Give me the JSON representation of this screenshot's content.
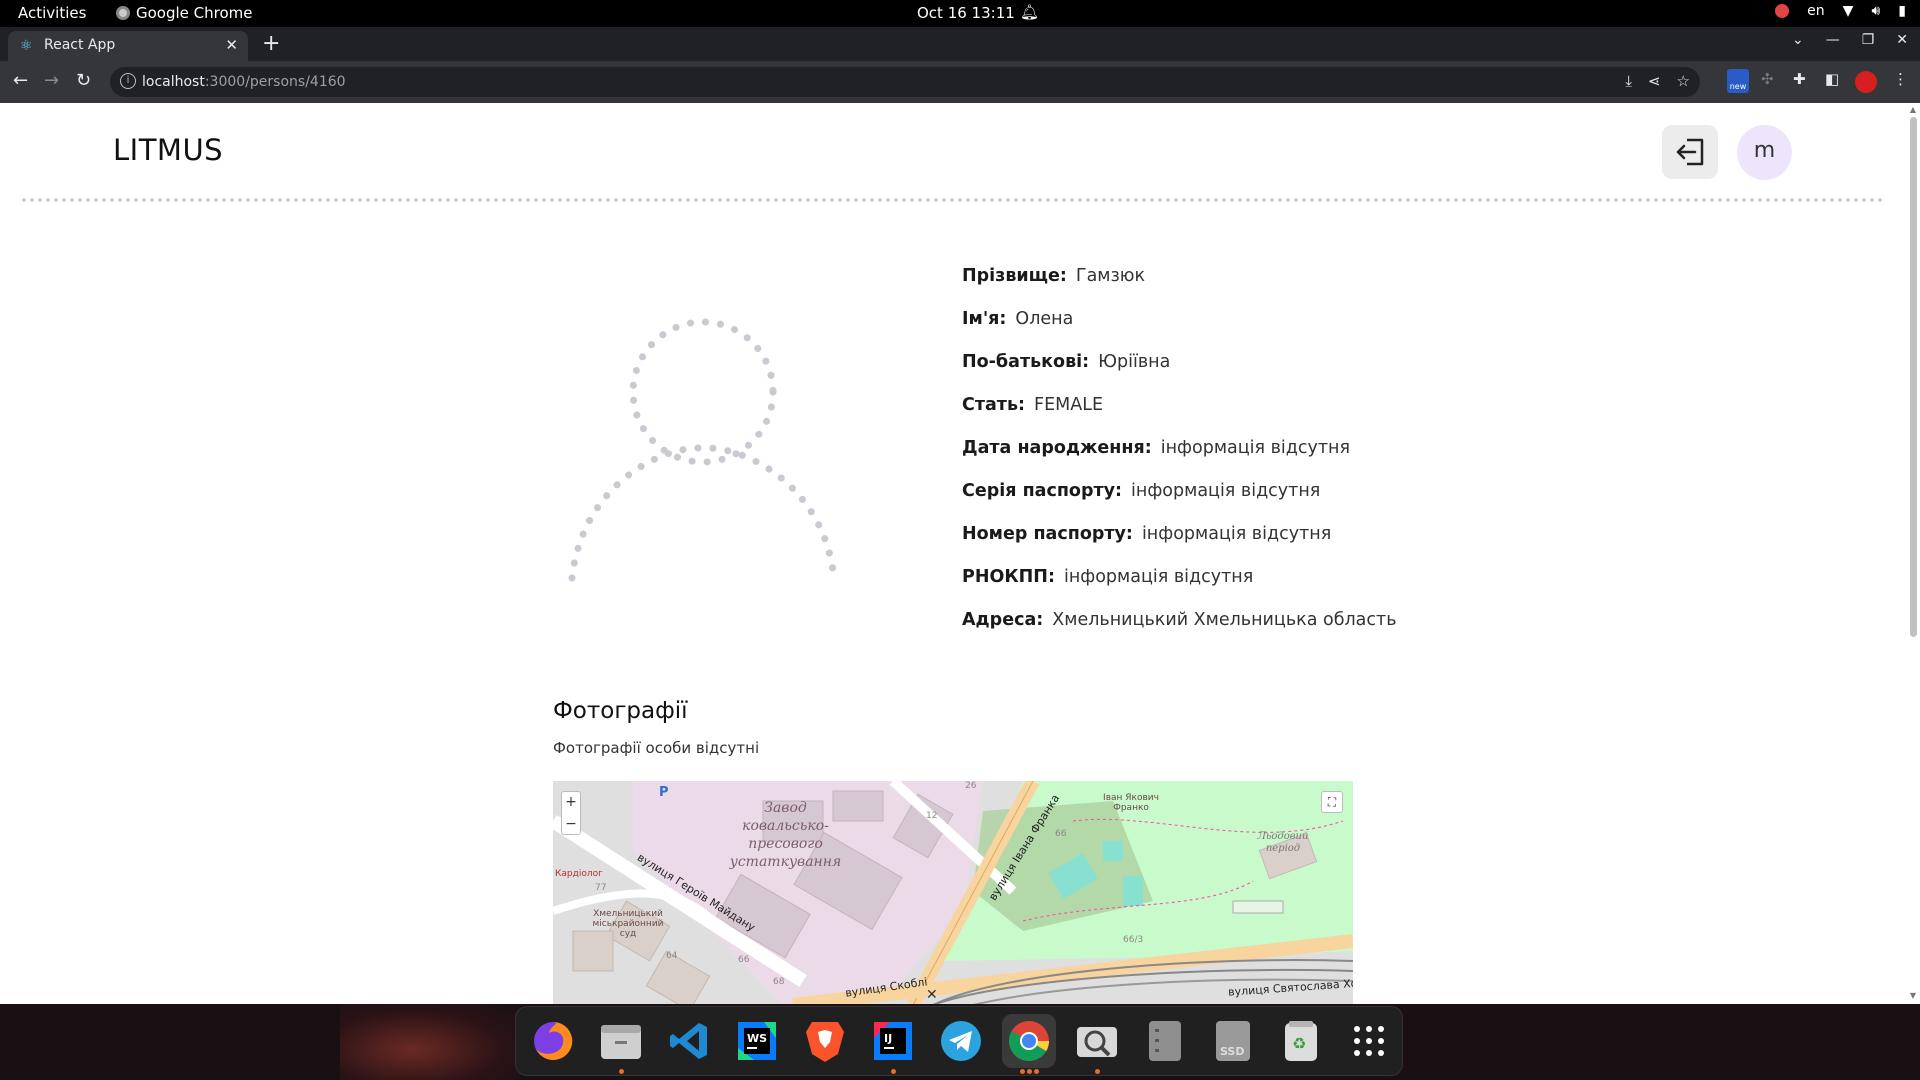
{
  "system": {
    "activities": "Activities",
    "app_name": "Google Chrome",
    "clock": "Oct 16  13:11",
    "lang": "en"
  },
  "browser": {
    "tab_title": "React App",
    "url_host": "localhost",
    "url_path": ":3000/persons/4160",
    "ext_new_label": "new"
  },
  "header": {
    "logo": "LITMUS",
    "avatar_letter": "m"
  },
  "person": {
    "fields": [
      {
        "label": "Прізвище:",
        "value": "Гамзюк"
      },
      {
        "label": "Ім'я:",
        "value": "Олена"
      },
      {
        "label": "По-батькові:",
        "value": "Юріївна"
      },
      {
        "label": "Стать:",
        "value": "FEMALE"
      },
      {
        "label": "Дата народження:",
        "value": "інформація відсутня"
      },
      {
        "label": "Серія паспорту:",
        "value": "інформація відсутня"
      },
      {
        "label": "Номер паспорту:",
        "value": "інформація відсутня"
      },
      {
        "label": "РНОКПП:",
        "value": "інформація відсутня"
      },
      {
        "label": "Адреса:",
        "value": "Хмельницький Хмельницька область"
      }
    ]
  },
  "photos": {
    "title": "Фотографії",
    "empty_text": "Фотографії особи відсутні"
  },
  "map": {
    "zoom_in": "+",
    "zoom_out": "−",
    "labels": {
      "factory": "Завод ковальсько-пресового устаткування",
      "period": "Льодовий період",
      "monument": "Іван Якович Франко",
      "court": "Хмельницький міськрайонний суд",
      "cardiolog": "Кардіолог",
      "street_heroes": "вулиця Героїв Майдану",
      "street_franko": "вулиця Івана Франка",
      "street_skobli": "вулиця Скоблі",
      "street_svyatoslav": "вулиця Святослава Хор",
      "num_12": "12",
      "num_26": "26",
      "num_66": "66",
      "num_663": "66/3",
      "num_77": "77",
      "num_64": "64",
      "num_66b": "66",
      "num_68": "68",
      "parking": "P"
    }
  },
  "dock": {
    "items": [
      "firefox",
      "files",
      "vscode",
      "webstorm",
      "brave",
      "intellij",
      "telegram",
      "chrome",
      "image-viewer",
      "disks",
      "ssd",
      "trash",
      "app-grid"
    ],
    "ws_label": "WS",
    "ij_label": "IJ",
    "ssd_label": "SSD"
  }
}
